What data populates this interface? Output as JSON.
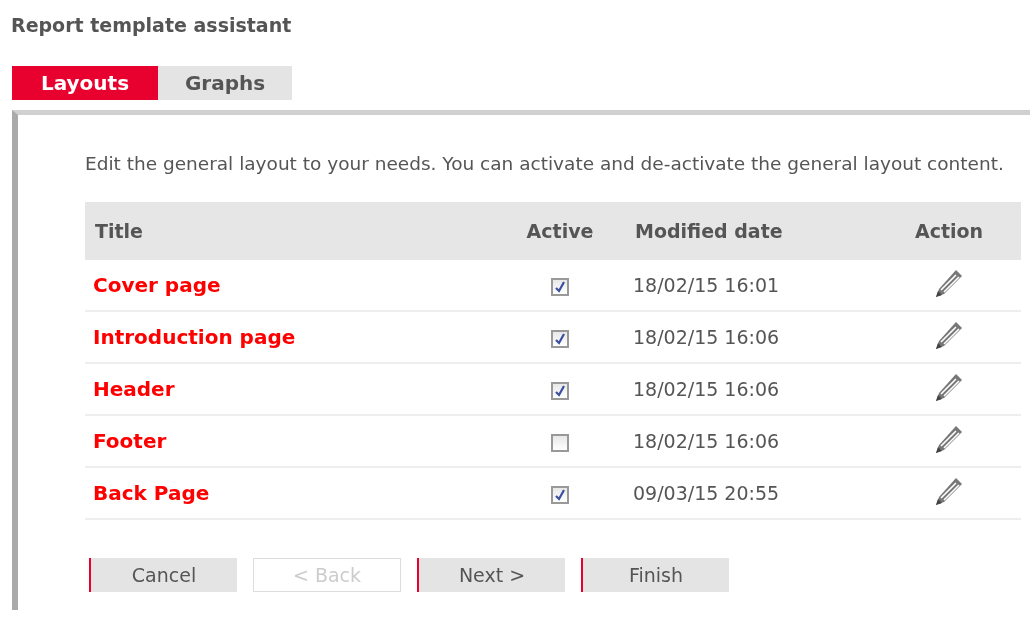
{
  "title": "Report template assistant",
  "tabs": [
    {
      "label": "Layouts",
      "selected": true
    },
    {
      "label": "Graphs",
      "selected": false
    }
  ],
  "description": "Edit the general layout to your needs. You can activate and de-activate the general layout content.",
  "table": {
    "columns": [
      "Title",
      "Active",
      "Modified date",
      "Action"
    ],
    "rows": [
      {
        "title": "Cover page",
        "active": true,
        "modified": "18/02/15 16:01"
      },
      {
        "title": "Introduction page",
        "active": true,
        "modified": "18/02/15 16:06"
      },
      {
        "title": "Header",
        "active": true,
        "modified": "18/02/15 16:06"
      },
      {
        "title": "Footer",
        "active": false,
        "modified": "18/02/15 16:06"
      },
      {
        "title": "Back Page",
        "active": true,
        "modified": "09/03/15 20:55"
      }
    ]
  },
  "buttons": [
    {
      "label": "Cancel",
      "disabled": false
    },
    {
      "label": "< Back",
      "disabled": true
    },
    {
      "label": "Next >",
      "disabled": false
    },
    {
      "label": "Finish",
      "disabled": false
    }
  ]
}
